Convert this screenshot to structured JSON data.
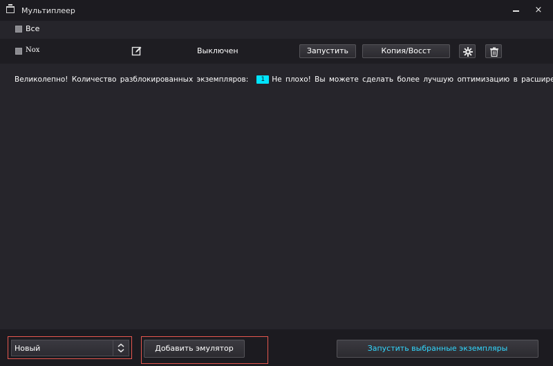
{
  "window": {
    "title": "Мультиплеер",
    "close_glyph": "×"
  },
  "select_all": {
    "label": "Все"
  },
  "instance": {
    "name": "Nox",
    "status": "Выключен",
    "start_label": "Запустить",
    "copy_label": "Копия/Восст",
    "icons": [
      "edit-icon",
      "gear-icon",
      "trash-icon"
    ]
  },
  "info": {
    "prefix": "Великолепно! Количество разблокированных экземпляров:",
    "count": "1",
    "suffix": "Не плохо! Вы можете сделать более лучшую оптимизацию в расширенных нас"
  },
  "bottom": {
    "select_value": "Новый",
    "add_label": "Добавить эмулятор",
    "launch_label": "Запустить выбранные экземпляры"
  },
  "colors": {
    "background": "#26252b",
    "titlebar": "#1c1b20",
    "accent_cyan": "#00e5ff",
    "launch_text": "#32d8ff",
    "highlight_red": "#e8584f"
  }
}
